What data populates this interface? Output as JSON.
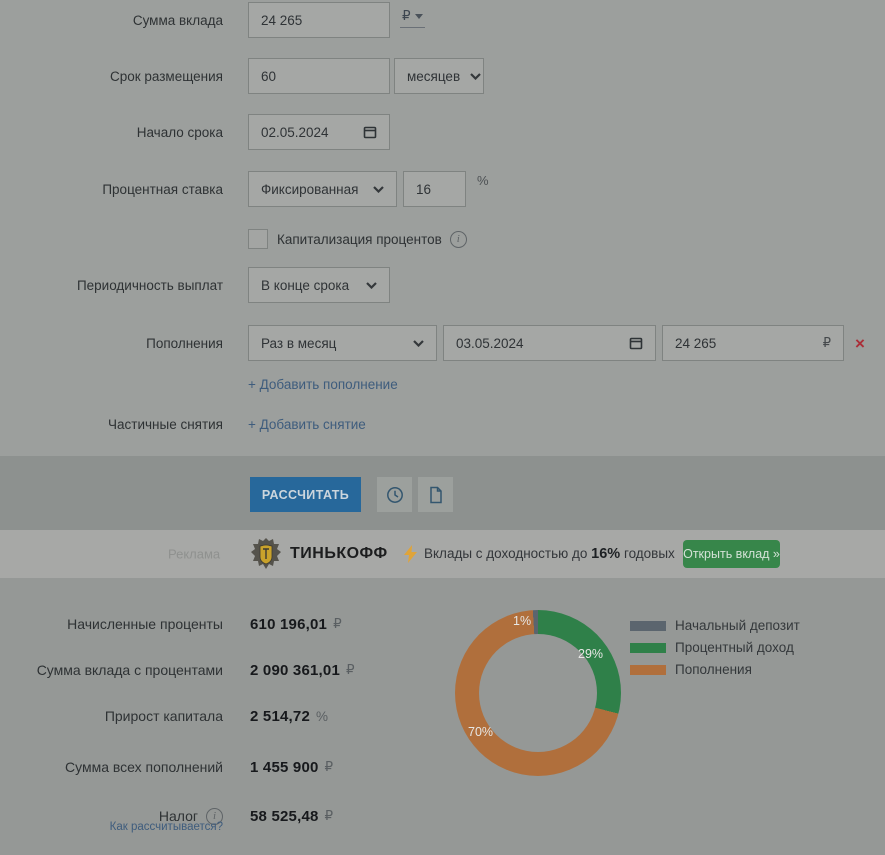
{
  "form": {
    "amount": {
      "label": "Сумма вклада",
      "value": "24 265",
      "currency": "₽"
    },
    "term": {
      "label": "Срок размещения",
      "value": "60",
      "unit": "месяцев"
    },
    "start_date": {
      "label": "Начало срока",
      "value": "02.05.2024"
    },
    "rate": {
      "label": "Процентная ставка",
      "type": "Фиксированная",
      "value": "16",
      "suffix": "%"
    },
    "capitalization": {
      "label": "Капитализация процентов",
      "checked": false
    },
    "frequency": {
      "label": "Периодичность выплат",
      "value": "В конце срока"
    },
    "topups": {
      "label": "Пополнения",
      "period": "Раз в месяц",
      "date": "03.05.2024",
      "amount": "24 265",
      "currency": "₽",
      "add_label": "+ Добавить пополнение"
    },
    "withdrawals": {
      "label": "Частичные снятия",
      "add_label": "+ Добавить снятие"
    }
  },
  "actions": {
    "calculate_label": "РАССЧИТАТЬ"
  },
  "ad": {
    "marker": "Реклама",
    "brand": "ТИНЬКОФФ",
    "text_prefix": "Вклады с доходностью до ",
    "rate": "16%",
    "text_suffix": " годовых",
    "button_label": "Открыть вклад »",
    "button_color": "#37864a"
  },
  "results": {
    "rows": [
      {
        "label": "Начисленные проценты",
        "value": "610 196,01",
        "unit": "₽"
      },
      {
        "label": "Сумма вклада с процентами",
        "value": "2 090 361,01",
        "unit": "₽"
      },
      {
        "label": "Прирост капитала",
        "value": "2 514,72",
        "unit": "%"
      },
      {
        "label": "Сумма всех пополнений",
        "value": "1 455 900",
        "unit": "₽"
      },
      {
        "label": "Налог",
        "value": "58 525,48",
        "unit": "₽"
      }
    ],
    "tax_sublink": "Как рассчитывается?"
  },
  "chart_data": {
    "type": "pie",
    "donut": true,
    "labels": [
      "Начальный депозит",
      "Процентный доход",
      "Пополнения"
    ],
    "values": [
      1,
      29,
      70
    ],
    "unit": "%",
    "display_labels": [
      "1%",
      "29%",
      "70%"
    ],
    "colors": [
      "#5b656e",
      "#2f8049",
      "#b06f3c"
    ],
    "legend_position": "right"
  }
}
